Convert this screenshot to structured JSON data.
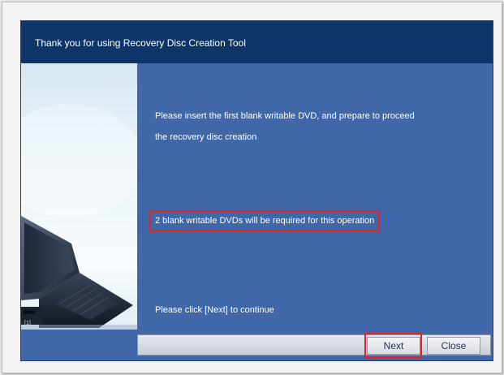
{
  "window": {
    "title": "Thank you for using Recovery Disc Creation Tool"
  },
  "content": {
    "line1": "Please insert the first blank writable DVD, and prepare to proceed",
    "line2": "the recovery disc creation",
    "requirement": "2 blank writable DVDs will be required for this operation",
    "instruction": "Please click [Next] to continue"
  },
  "buttons": {
    "next": "Next",
    "close": "Close"
  },
  "colors": {
    "title_bar": "#0d3567",
    "panel": "#4068a8",
    "highlight": "#e52222"
  }
}
